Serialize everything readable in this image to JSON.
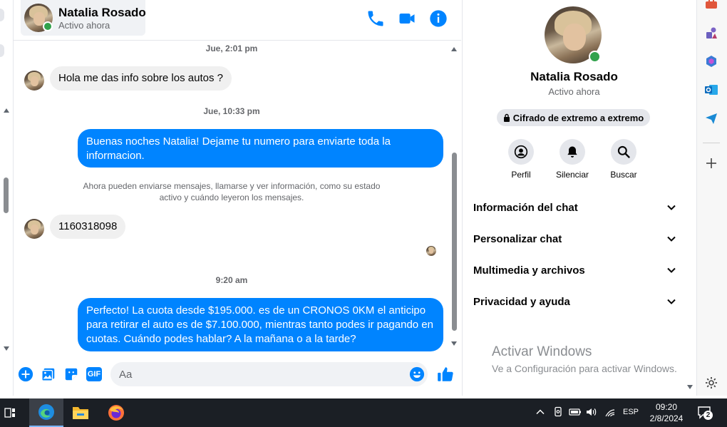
{
  "contact": {
    "name": "Natalia Rosado",
    "status": "Activo ahora"
  },
  "messages": {
    "ts1": "Jue, 2:01 pm",
    "in1": "Hola me das info sobre los autos ?",
    "ts2": "Jue, 10:33 pm",
    "out1": "Buenas noches Natalia! Dejame tu numero para enviarte toda la informacion.",
    "system_note": "Ahora pueden enviarse mensajes, llamarse y ver información, como su estado activo y cuándo leyeron los mensajes.",
    "in2": "1160318098",
    "ts3": "9:20 am",
    "out2": "Perfecto! La cuota desde $195.000. es de un CRONOS 0KM el anticipo para retirar el auto es de $7.100.000, mientras tanto podes ir pagando en cuotas. Cuándo podes hablar? A la mañana o a la tarde?"
  },
  "composer": {
    "placeholder": "Aa",
    "gif_label": "GIF"
  },
  "panel": {
    "encryption": "Cifrado de extremo a extremo",
    "actions": [
      {
        "label": "Perfil",
        "icon": "profile-icon"
      },
      {
        "label": "Silenciar",
        "icon": "bell-icon"
      },
      {
        "label": "Buscar",
        "icon": "search-icon"
      }
    ],
    "sections": [
      {
        "label": "Información del chat"
      },
      {
        "label": "Personalizar chat"
      },
      {
        "label": "Multimedia y archivos"
      },
      {
        "label": "Privacidad y ayuda"
      }
    ]
  },
  "watermark": {
    "title": "Activar Windows",
    "subtitle": "Ve a Configuración para activar Windows."
  },
  "taskbar": {
    "lang": "ESP",
    "time": "09:20",
    "date": "2/8/2024",
    "notifications": "2"
  },
  "colors": {
    "accent": "#0084ff",
    "online": "#31a24c"
  }
}
